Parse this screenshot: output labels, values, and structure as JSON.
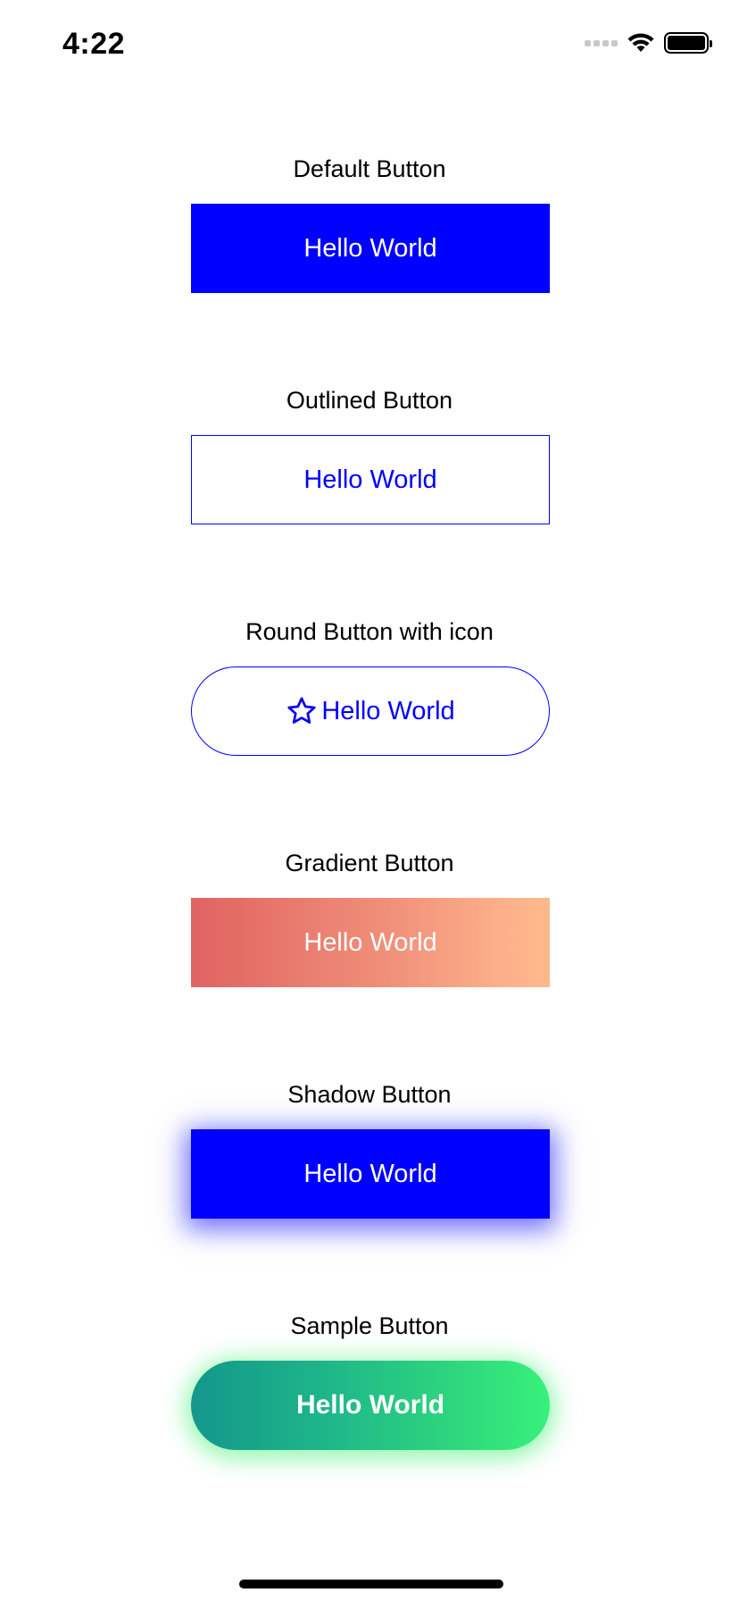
{
  "status_bar": {
    "time": "4:22"
  },
  "sections": [
    {
      "label": "Default Button",
      "button_label": "Hello World"
    },
    {
      "label": "Outlined Button",
      "button_label": "Hello World"
    },
    {
      "label": "Round Button with icon",
      "button_label": "Hello World",
      "icon": "star-outline-icon"
    },
    {
      "label": "Gradient Button",
      "button_label": "Hello World"
    },
    {
      "label": "Shadow Button",
      "button_label": "Hello World"
    },
    {
      "label": "Sample Button",
      "button_label": "Hello World"
    }
  ],
  "colors": {
    "primary_blue": "#0000ff",
    "gradient_start": "#e06363",
    "gradient_end": "#ffb98c",
    "sample_gradient_start": "#13978c",
    "sample_gradient_end": "#38f27c",
    "background": "#ffffff"
  }
}
